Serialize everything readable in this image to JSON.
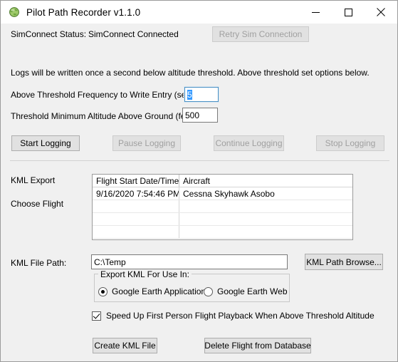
{
  "window": {
    "title": "Pilot Path Recorder v1.1.0",
    "icon": "globe-icon",
    "minimize_label": "—",
    "maximize_label": "□",
    "close_label": "✕",
    "background_color": "#f0f0f0"
  },
  "status": {
    "label": "SimConnect Status:",
    "value": "SimConnect Connected",
    "retry_button_label": "Retry Sim Connection",
    "retry_button_enabled": false
  },
  "info": {
    "text": "Logs will be written once a second below altitude threshold.  Above threshold set options below."
  },
  "settings": {
    "frequency": {
      "label": "Above Threshold Frequency to Write Entry (secs):",
      "value": "5",
      "selected": true,
      "focused": true
    },
    "threshold_altitude": {
      "label": "Threshold Minimum Altitude Above Ground (feet):",
      "value": "500"
    }
  },
  "logging_buttons": [
    {
      "label": "Start Logging",
      "enabled": true
    },
    {
      "label": "Pause Logging",
      "enabled": false
    },
    {
      "label": "Continue Logging",
      "enabled": false
    },
    {
      "label": "Stop Logging",
      "enabled": false
    }
  ],
  "kml_export": {
    "section_label": "KML Export",
    "choose_flight_label": "Choose Flight",
    "grid": {
      "columns": [
        "Flight Start Date/Time",
        "Aircraft"
      ],
      "rows": [
        [
          "9/16/2020 7:54:46 PM",
          "Cessna Skyhawk Asobo"
        ],
        [
          "",
          ""
        ],
        [
          "",
          ""
        ],
        [
          "",
          ""
        ]
      ]
    },
    "file_path": {
      "label": "KML File Path:",
      "value": "C:\\Temp"
    },
    "browse_button_label": "KML Path Browse...",
    "export_group": {
      "title": "Export KML For Use In:",
      "options": [
        {
          "label": "Google Earth Application",
          "selected": true
        },
        {
          "label": "Google Earth Web",
          "selected": false
        }
      ]
    },
    "speed_up_checkbox": {
      "label": "Speed Up First Person Flight Playback When Above Threshold Altitude",
      "checked": true
    },
    "create_button_label": "Create KML File",
    "delete_button_label": "Delete Flight from Database"
  }
}
